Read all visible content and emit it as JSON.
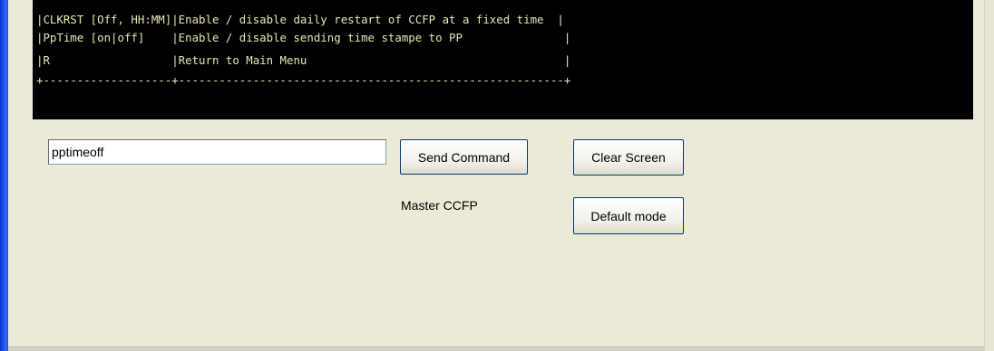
{
  "console": {
    "lines": [
      "|CLKRST [Off, HH:MM]|Enable / disable daily restart of CCFP at a fixed time  |",
      "|PpTime [on|off]    |Enable / disable sending time stampe to PP               |",
      "|R                  |Return to Main Menu                                      |",
      "+-------------------+---------------------------------------------------------+"
    ]
  },
  "command": {
    "value": "pptimeoff"
  },
  "buttons": {
    "send": "Send Command",
    "clear": "Clear Screen",
    "default_mode": "Default mode"
  },
  "status": "Master CCFP"
}
